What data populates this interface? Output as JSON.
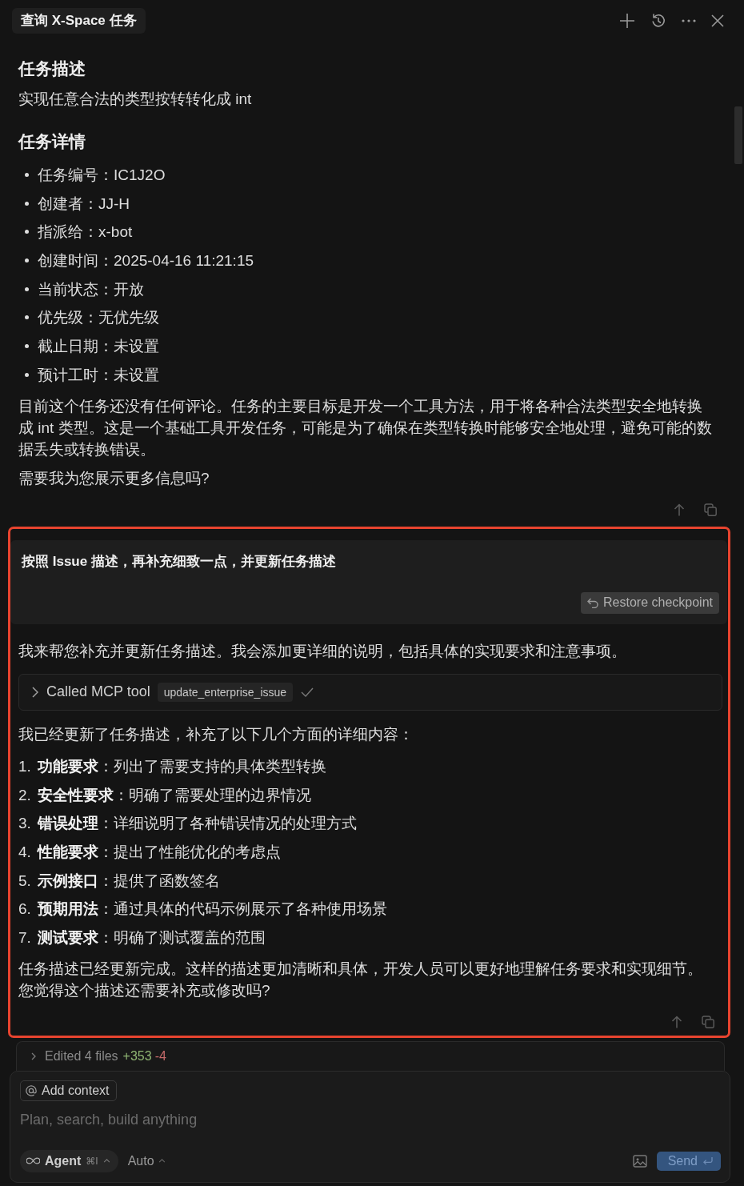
{
  "header": {
    "title": "查询 X-Space 任务"
  },
  "thread": [
    {
      "kind": "assistant",
      "blocks": [
        {
          "kind": "heading",
          "text": "任务描述"
        },
        {
          "kind": "paragraph",
          "text": "实现任意合法的类型按转转化成 int"
        },
        {
          "kind": "heading",
          "text": "任务详情"
        },
        {
          "kind": "bullets",
          "items": [
            "任务编号：IC1J2O",
            "创建者：JJ-H",
            "指派给：x-bot",
            "创建时间：2025-04-16 11:21:15",
            "当前状态：开放",
            "优先级：无优先级",
            "截止日期：未设置",
            "预计工时：未设置"
          ]
        },
        {
          "kind": "paragraph",
          "text": "目前这个任务还没有任何评论。任务的主要目标是开发一个工具方法，用于将各种合法类型安全地转换成 int 类型。这是一个基础工具开发任务，可能是为了确保在类型转换时能够安全地处理，避免可能的数据丢失或转换错误。"
        },
        {
          "kind": "paragraph",
          "text": "需要我为您展示更多信息吗?"
        }
      ]
    },
    {
      "kind": "highlight",
      "messages": [
        {
          "kind": "user",
          "text": "按照 Issue 描述，再补充细致一点，并更新任务描述",
          "button": "Restore checkpoint"
        },
        {
          "kind": "assistant",
          "blocks": [
            {
              "kind": "paragraph",
              "text": "我来帮您补充并更新任务描述。我会添加更详细的说明，包括具体的实现要求和注意事项。"
            },
            {
              "kind": "tool_call",
              "label": "Called MCP tool",
              "tool": "update_enterprise_issue",
              "done": true
            },
            {
              "kind": "paragraph",
              "text": "我已经更新了任务描述，补充了以下几个方面的详细内容："
            },
            {
              "kind": "numbered",
              "items": [
                {
                  "number": "1.",
                  "text": "**功能要求**：列出了需要支持的具体类型转换"
                },
                {
                  "number": "2.",
                  "text": "**安全性要求**：明确了需要处理的边界情况"
                },
                {
                  "number": "3.",
                  "text": "**错误处理**：详细说明了各种错误情况的处理方式"
                },
                {
                  "number": "4.",
                  "text": "**性能要求**：提出了性能优化的考虑点"
                },
                {
                  "number": "5.",
                  "text": "**示例接口**：提供了函数签名"
                },
                {
                  "number": "6.",
                  "text": "**预期用法**：通过具体的代码示例展示了各种使用场景"
                },
                {
                  "number": "7.",
                  "text": "**测试要求**：明确了测试覆盖的范围"
                }
              ]
            },
            {
              "kind": "paragraph",
              "text": "任务描述已经更新完成。这样的描述更加清晰和具体，开发人员可以更好地理解任务要求和实现细节。您觉得这个描述还需要补充或修改吗?"
            }
          ]
        }
      ]
    }
  ],
  "edited_files": {
    "label": "Edited 4 files",
    "added": "+353",
    "removed": "-4"
  },
  "composer": {
    "context_button": "Add context",
    "placeholder": "Plan, search, build anything",
    "mode": "Agent",
    "shortcut": "⌘I",
    "model": "Auto",
    "send_button": "Send"
  }
}
